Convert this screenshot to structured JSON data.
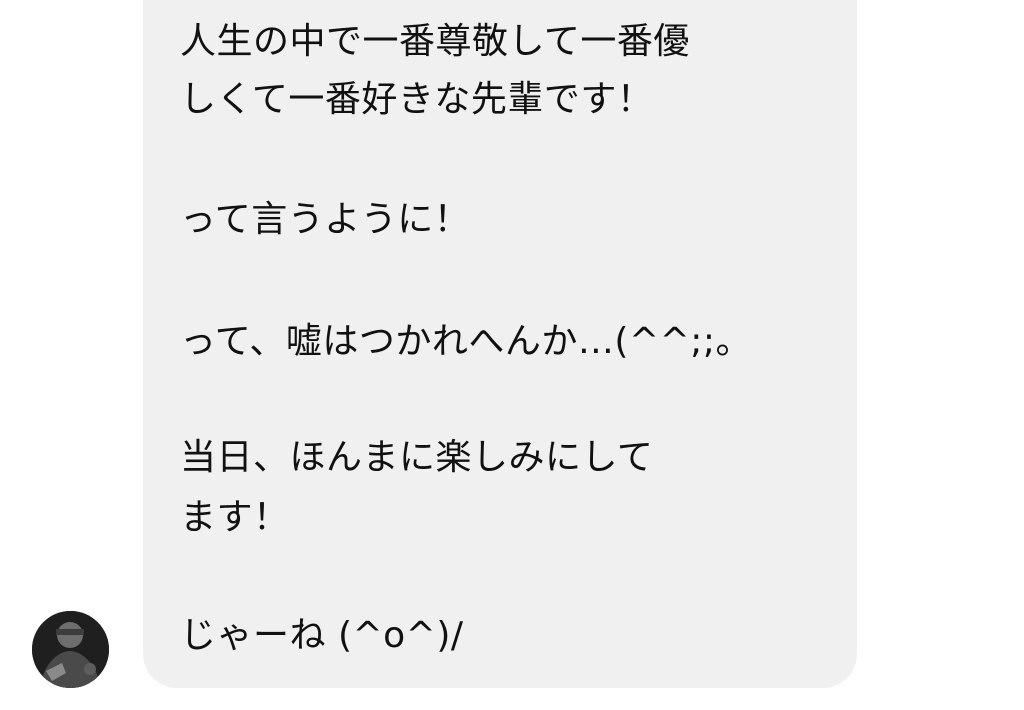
{
  "conversation": {
    "message": {
      "lines": [
        "人生の中で一番尊敬して一番優",
        "しくて一番好きな先輩です！",
        "って言うように！",
        "って、嘘はつかれへんか…(^^;;。",
        "当日、ほんまに楽しみにして",
        "ます！",
        "じゃーね (^o^)/"
      ]
    },
    "sender": {
      "avatar_icon": "user-avatar-photo"
    }
  },
  "colors": {
    "bubble": "#f0f0f0",
    "text": "#111111",
    "background": "#ffffff"
  }
}
